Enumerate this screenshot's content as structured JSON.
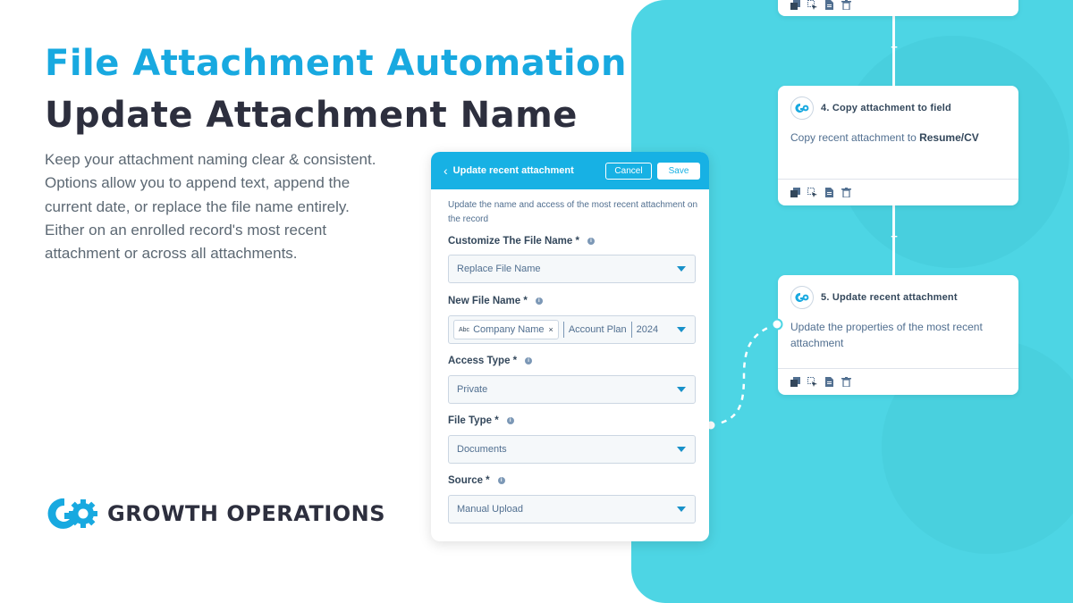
{
  "headline": {
    "title": "File Attachment Automation",
    "subtitle": "Update Attachment Name",
    "description_lines": [
      "Keep your attachment naming clear & consistent.",
      "Options allow you to append text, append the",
      "current date, or replace the file name entirely.",
      "Either on an enrolled record's most recent",
      "attachment or across all attachments."
    ]
  },
  "brand": {
    "name": "GROWTH OPERATIONS",
    "accent": "#18a9e0",
    "dark": "#2d2f3e",
    "teal": "#4dd5e4"
  },
  "form": {
    "header_title": "Update recent attachment",
    "cancel_label": "Cancel",
    "save_label": "Save",
    "intro": "Update the name and access of the most recent attachment on the record",
    "fields": {
      "customize": {
        "label": "Customize The File Name *",
        "value": "Replace File Name"
      },
      "new_name": {
        "label": "New File Name *",
        "chip_type": "Abc",
        "chip_label": "Company Name",
        "chip_remove": "×",
        "token1": "Account Plan",
        "token2": "2024"
      },
      "access": {
        "label": "Access Type *",
        "value": "Private"
      },
      "file_type": {
        "label": "File Type *",
        "value": "Documents"
      },
      "source": {
        "label": "Source *",
        "value": "Manual Upload"
      }
    },
    "info_glyph": "i"
  },
  "workflow": {
    "plus_glyph": "+",
    "cards": [
      {
        "title": "4. Copy attachment to field",
        "body_prefix": "Copy recent attachment to ",
        "body_bold": "Resume/CV"
      },
      {
        "title": "5. Update recent attachment",
        "body": "Update the properties of the most recent attachment"
      }
    ],
    "footer_icons": [
      "clone-icon",
      "select-icon",
      "document-icon",
      "trash-icon"
    ]
  }
}
